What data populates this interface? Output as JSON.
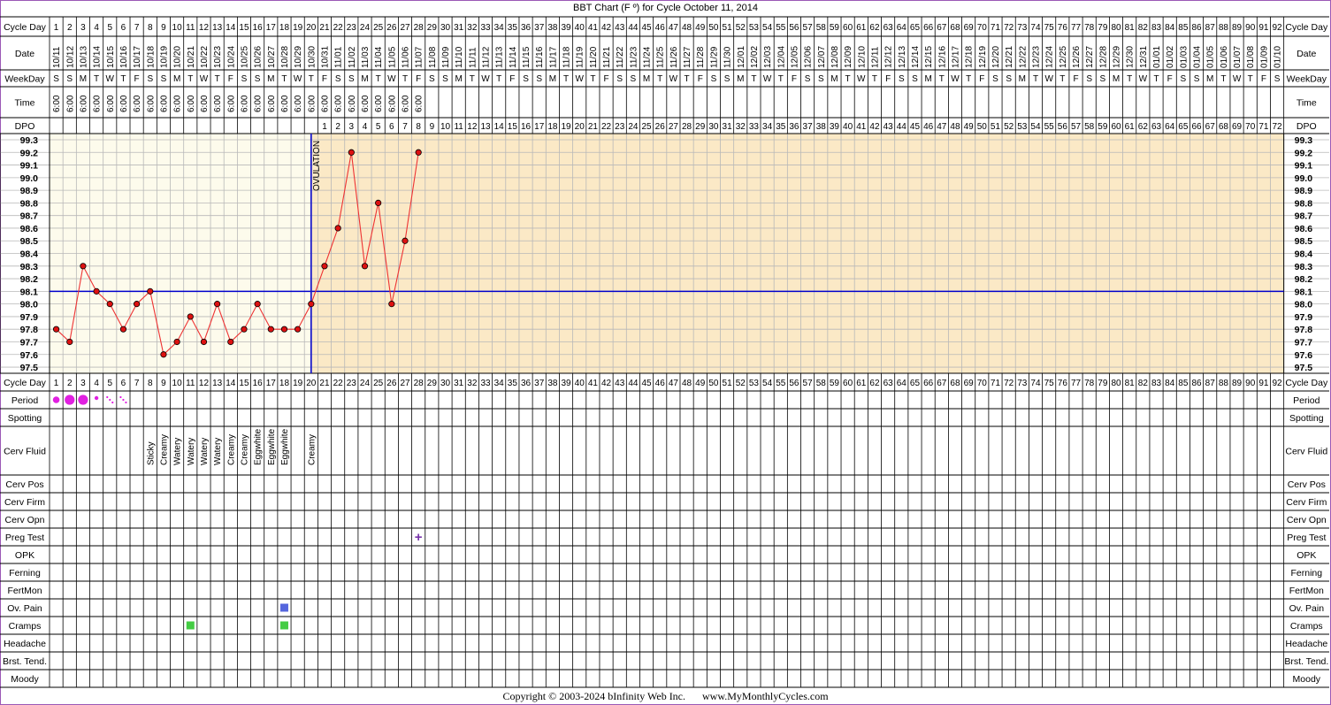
{
  "title": "BBT Chart (F º) for Cycle October 11, 2014",
  "copyright": "Copyright © 2003-2024 bInfinity Web Inc.",
  "website": "www.MyMonthlyCycles.com",
  "row_labels": {
    "cycle_day": "Cycle Day",
    "date": "Date",
    "weekday": "WeekDay",
    "time": "Time",
    "dpo": "DPO",
    "period": "Period",
    "spotting": "Spotting",
    "cerv_fluid": "Cerv Fluid",
    "cerv_pos": "Cerv Pos",
    "cerv_firm": "Cerv Firm",
    "cerv_opn": "Cerv Opn",
    "preg_test": "Preg Test",
    "opk": "OPK",
    "ferning": "Ferning",
    "fertmon": "FertMon",
    "ov_pain": "Ov. Pain",
    "cramps": "Cramps",
    "headache": "Headache",
    "brst_tend": "Brst. Tend.",
    "moody": "Moody"
  },
  "ovulation_label": "OVULATION",
  "colors": {
    "frame": "#9b59b6",
    "pre_ovulation_bg": "#fdfbec",
    "post_ovulation_bg": "#fbe9c6",
    "grid": "#b8b8b8",
    "temp_line": "#ee3333",
    "temp_point": "#dd1111",
    "coverline": "#0000cc",
    "ovulation_line": "#1a1acc",
    "period_marker": "#e020e0",
    "preg_test_marker": "#7733aa",
    "ov_pain_marker": "#5566dd",
    "cramps_marker": "#44cc44"
  },
  "chart_data": {
    "type": "line",
    "title": "BBT Chart (F º) for Cycle October 11, 2014",
    "num_days": 92,
    "x": [
      1,
      2,
      3,
      4,
      5,
      6,
      7,
      8,
      9,
      10,
      11,
      12,
      13,
      14,
      15,
      16,
      17,
      18,
      19,
      20,
      21,
      22,
      23,
      24,
      25,
      26,
      27,
      28
    ],
    "y": [
      97.8,
      97.7,
      98.3,
      98.1,
      98.0,
      97.8,
      98.0,
      98.1,
      97.6,
      97.7,
      97.9,
      97.7,
      98.0,
      97.7,
      97.8,
      98.0,
      97.8,
      97.8,
      97.8,
      98.0,
      98.3,
      98.6,
      99.2,
      98.3,
      98.8,
      98.0,
      98.5,
      99.2
    ],
    "ylim": [
      97.5,
      99.3
    ],
    "y_ticks": [
      "99.3",
      "99.2",
      "99.1",
      "99.0",
      "98.9",
      "98.8",
      "98.7",
      "98.6",
      "98.5",
      "98.4",
      "98.3",
      "98.2",
      "98.1",
      "98.0",
      "97.9",
      "97.8",
      "97.7",
      "97.6",
      "97.5"
    ],
    "coverline": 98.1,
    "ovulation_day": 20,
    "dates": [
      "10/11",
      "10/12",
      "10/13",
      "10/14",
      "10/15",
      "10/16",
      "10/17",
      "10/18",
      "10/19",
      "10/20",
      "10/21",
      "10/22",
      "10/23",
      "10/24",
      "10/25",
      "10/26",
      "10/27",
      "10/28",
      "10/29",
      "10/30",
      "10/31",
      "11/01",
      "11/02",
      "11/03",
      "11/04",
      "11/05",
      "11/06",
      "11/07",
      "11/08",
      "11/09",
      "11/10",
      "11/11",
      "11/12",
      "11/13",
      "11/14",
      "11/15",
      "11/16",
      "11/17",
      "11/18",
      "11/19",
      "11/20",
      "11/21",
      "11/22",
      "11/23",
      "11/24",
      "11/25",
      "11/26",
      "11/27",
      "11/28",
      "11/29",
      "11/30",
      "12/01",
      "12/02",
      "12/03",
      "12/04",
      "12/05",
      "12/06",
      "12/07",
      "12/08",
      "12/09",
      "12/10",
      "12/11",
      "12/12",
      "12/13",
      "12/14",
      "12/15",
      "12/16",
      "12/17",
      "12/18",
      "12/19",
      "12/20",
      "12/21",
      "12/22",
      "12/23",
      "12/24",
      "12/25",
      "12/26",
      "12/27",
      "12/28",
      "12/29",
      "12/30",
      "12/31",
      "01/01",
      "01/02",
      "01/03",
      "01/04",
      "01/05",
      "01/06",
      "01/07",
      "01/08",
      "01/09",
      "01/10"
    ],
    "weekdays": [
      "S",
      "S",
      "M",
      "T",
      "W",
      "T",
      "F",
      "S",
      "S",
      "M",
      "T",
      "W",
      "T",
      "F",
      "S",
      "S",
      "M",
      "T",
      "W",
      "T",
      "F",
      "S",
      "S",
      "M",
      "T",
      "W",
      "T",
      "F",
      "S",
      "S",
      "M",
      "T",
      "W",
      "T",
      "F",
      "S",
      "S",
      "M",
      "T",
      "W",
      "T",
      "F",
      "S",
      "S",
      "M",
      "T",
      "W",
      "T",
      "F",
      "S",
      "S",
      "M",
      "T",
      "W",
      "T",
      "F",
      "S",
      "S",
      "M",
      "T",
      "W",
      "T",
      "F",
      "S",
      "S",
      "M",
      "T",
      "W",
      "T",
      "F",
      "S",
      "S",
      "M",
      "T",
      "W",
      "T",
      "F",
      "S",
      "S",
      "M",
      "T",
      "W",
      "T",
      "F",
      "S",
      "S",
      "M",
      "T",
      "W",
      "T",
      "F",
      "S"
    ],
    "times": [
      "6:00",
      "6:00",
      "6:00",
      "6:00",
      "6:00",
      "6:00",
      "6:00",
      "6:00",
      "6:00",
      "6:00",
      "6:00",
      "6:00",
      "6:00",
      "6:00",
      "6:00",
      "6:00",
      "6:00",
      "6:00",
      "6:00",
      "6:00",
      "6:00",
      "6:00",
      "6:00",
      "6:00",
      "6:00",
      "6:00",
      "6:00",
      "6:00"
    ],
    "dpo_start_day": 21,
    "dpo_count": 72,
    "period": [
      {
        "day": 1,
        "type": "medium"
      },
      {
        "day": 2,
        "type": "heavy"
      },
      {
        "day": 3,
        "type": "heavy"
      },
      {
        "day": 4,
        "type": "light"
      },
      {
        "day": 5,
        "type": "spotting"
      },
      {
        "day": 6,
        "type": "spotting"
      }
    ],
    "cerv_fluid": [
      {
        "day": 8,
        "value": "Sticky"
      },
      {
        "day": 9,
        "value": "Creamy"
      },
      {
        "day": 10,
        "value": "Watery"
      },
      {
        "day": 11,
        "value": "Watery"
      },
      {
        "day": 12,
        "value": "Watery"
      },
      {
        "day": 13,
        "value": "Watery"
      },
      {
        "day": 14,
        "value": "Creamy"
      },
      {
        "day": 15,
        "value": "Creamy"
      },
      {
        "day": 16,
        "value": "Eggwhite"
      },
      {
        "day": 17,
        "value": "Eggwhite"
      },
      {
        "day": 18,
        "value": "Eggwhite"
      },
      {
        "day": 20,
        "value": "Creamy"
      }
    ],
    "preg_test": [
      {
        "day": 28,
        "symbol": "+"
      }
    ],
    "ov_pain": [
      {
        "day": 18
      }
    ],
    "cramps": [
      {
        "day": 11
      },
      {
        "day": 18
      }
    ]
  }
}
